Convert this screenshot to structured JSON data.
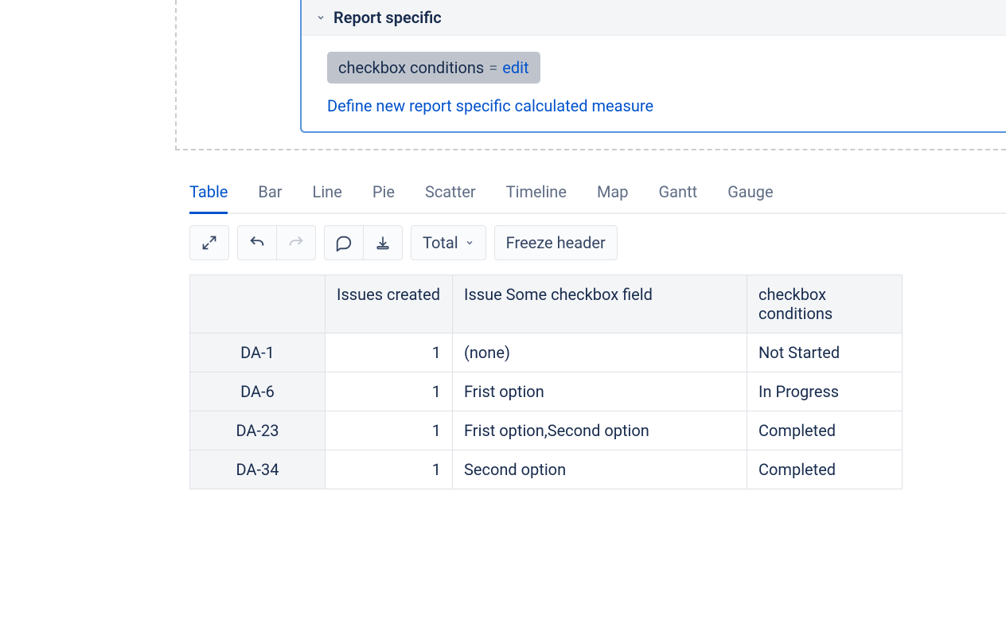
{
  "section": {
    "title": "Report specific",
    "chip": {
      "name": "checkbox conditions",
      "op": "=",
      "action": "edit"
    },
    "define_link": "Define new report specific calculated measure"
  },
  "tabs": [
    "Table",
    "Bar",
    "Line",
    "Pie",
    "Scatter",
    "Timeline",
    "Map",
    "Gantt",
    "Gauge"
  ],
  "active_tab": 0,
  "toolbar": {
    "total_label": "Total",
    "freeze_label": "Freeze header"
  },
  "table": {
    "headers": {
      "row": "",
      "issues_created": "Issues created",
      "checkbox_field": "Issue Some checkbox field",
      "conditions": "checkbox conditions"
    },
    "rows": [
      {
        "key": "DA-1",
        "issues": "1",
        "field": "(none)",
        "cond": "Not Started"
      },
      {
        "key": "DA-6",
        "issues": "1",
        "field": "Frist option",
        "cond": "In Progress"
      },
      {
        "key": "DA-23",
        "issues": "1",
        "field": "Frist option,Second option",
        "cond": "Completed"
      },
      {
        "key": "DA-34",
        "issues": "1",
        "field": "Second option",
        "cond": "Completed"
      }
    ]
  },
  "chart_data": {
    "type": "table",
    "columns": [
      "Issues created",
      "Issue Some checkbox field",
      "checkbox conditions"
    ],
    "rows": [
      [
        "DA-1",
        1,
        "(none)",
        "Not Started"
      ],
      [
        "DA-6",
        1,
        "Frist option",
        "In Progress"
      ],
      [
        "DA-23",
        1,
        "Frist option,Second option",
        "Completed"
      ],
      [
        "DA-34",
        1,
        "Second option",
        "Completed"
      ]
    ]
  }
}
